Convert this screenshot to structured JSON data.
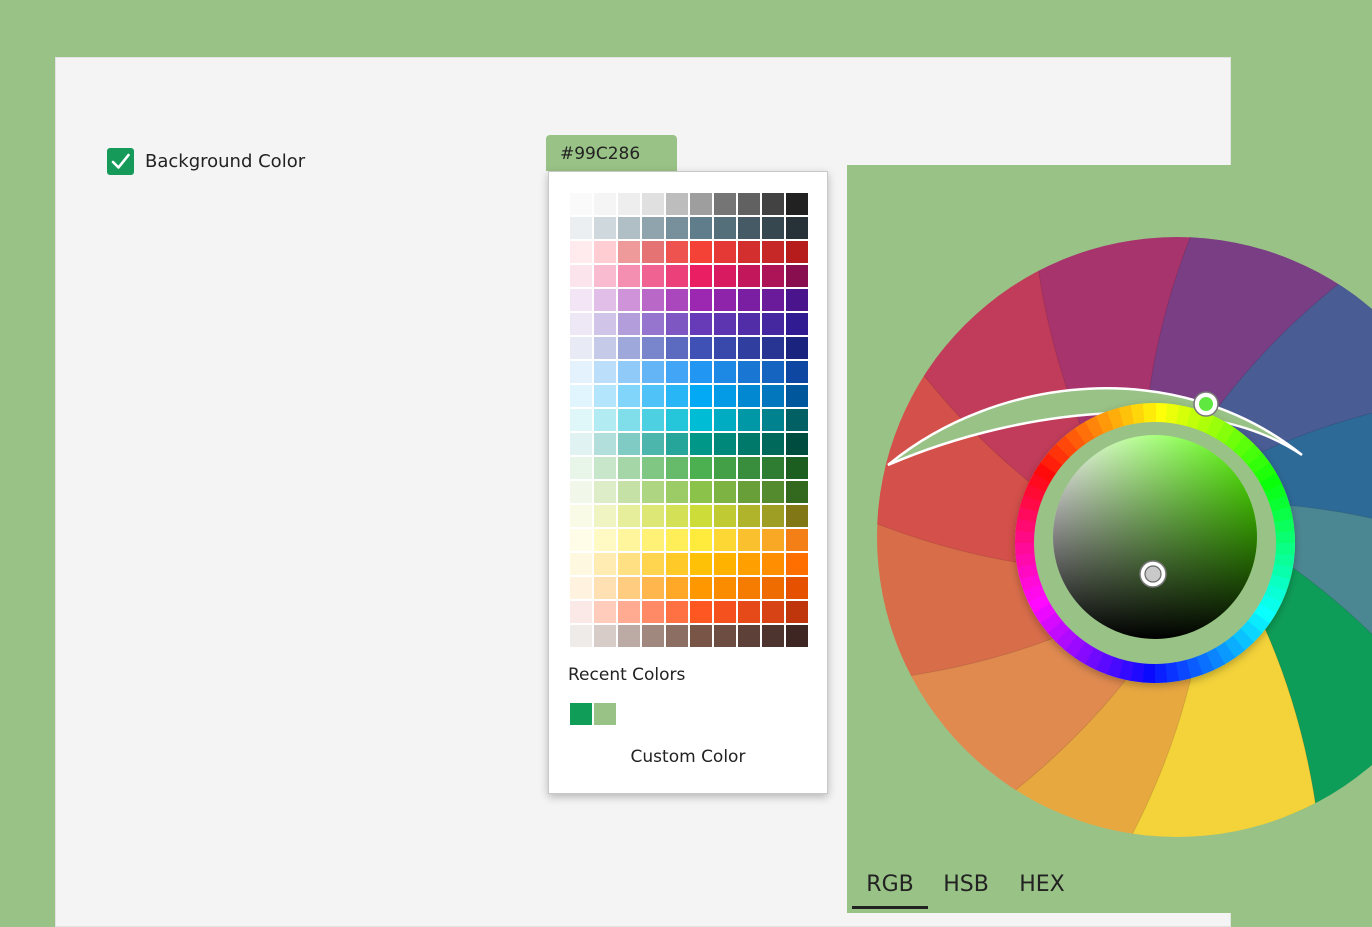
{
  "background_option": {
    "label": "Background Color",
    "checked": true
  },
  "current_color": {
    "hex": "#99C286"
  },
  "palette": {
    "swatch_rows": [
      [
        "#FAFAFA",
        "#F5F5F5",
        "#EEEEEE",
        "#E0E0E0",
        "#BDBDBD",
        "#9E9E9E",
        "#757575",
        "#616161",
        "#424242",
        "#212121"
      ],
      [
        "#ECEFF1",
        "#CFD8DC",
        "#B0BEC5",
        "#90A4AE",
        "#78909C",
        "#607D8B",
        "#546E7A",
        "#455A64",
        "#37474F",
        "#263238"
      ],
      [
        "#FFEBEE",
        "#FFCDD2",
        "#EF9A9A",
        "#E57373",
        "#EF5350",
        "#F44336",
        "#E53935",
        "#D32F2F",
        "#C62828",
        "#B71C1C"
      ],
      [
        "#FCE4EC",
        "#F8BBD0",
        "#F48FB1",
        "#F06292",
        "#EC407A",
        "#E91E63",
        "#D81B60",
        "#C2185B",
        "#AD1457",
        "#880E4F"
      ],
      [
        "#F3E5F5",
        "#E1BEE7",
        "#CE93D8",
        "#BA68C8",
        "#AB47BC",
        "#9C27B0",
        "#8E24AA",
        "#7B1FA2",
        "#6A1B9A",
        "#4A148C"
      ],
      [
        "#EDE7F6",
        "#D1C4E9",
        "#B39DDB",
        "#9575CD",
        "#7E57C2",
        "#673AB7",
        "#5E35B1",
        "#512DA8",
        "#4527A0",
        "#311B92"
      ],
      [
        "#E8EAF6",
        "#C5CAE9",
        "#9FA8DA",
        "#7986CB",
        "#5C6BC0",
        "#3F51B5",
        "#3949AB",
        "#303F9F",
        "#283593",
        "#1A237E"
      ],
      [
        "#E3F2FD",
        "#BBDEFB",
        "#90CAF9",
        "#64B5F6",
        "#42A5F5",
        "#2196F3",
        "#1E88E5",
        "#1976D2",
        "#1565C0",
        "#0D47A1"
      ],
      [
        "#E1F5FE",
        "#B3E5FC",
        "#81D4FA",
        "#4FC3F7",
        "#29B6F6",
        "#03A9F4",
        "#039BE5",
        "#0288D1",
        "#0277BD",
        "#01579B"
      ],
      [
        "#E0F7FA",
        "#B2EBF2",
        "#80DEEA",
        "#4DD0E1",
        "#26C6DA",
        "#00BCD4",
        "#00ACC1",
        "#0097A7",
        "#00838F",
        "#006064"
      ],
      [
        "#E0F2F1",
        "#B2DFDB",
        "#80CBC4",
        "#4DB6AC",
        "#26A69A",
        "#009688",
        "#00897B",
        "#00796B",
        "#00695C",
        "#004D40"
      ],
      [
        "#E8F5E9",
        "#C8E6C9",
        "#A5D6A7",
        "#81C784",
        "#66BB6A",
        "#4CAF50",
        "#43A047",
        "#388E3C",
        "#2E7D32",
        "#1B5E20"
      ],
      [
        "#F1F8E9",
        "#DCEDC8",
        "#C5E1A5",
        "#AED581",
        "#9CCC65",
        "#8BC34A",
        "#7CB342",
        "#689F38",
        "#558B2F",
        "#33691E"
      ],
      [
        "#F9FBE7",
        "#F0F4C3",
        "#E6EE9C",
        "#DCE775",
        "#D4E157",
        "#CDDC39",
        "#C0CA33",
        "#AFB42B",
        "#9E9D24",
        "#827717"
      ],
      [
        "#FFFDE7",
        "#FFF9C4",
        "#FFF59D",
        "#FFF176",
        "#FFEE58",
        "#FFEB3B",
        "#FDD835",
        "#FBC02D",
        "#F9A825",
        "#F57F17"
      ],
      [
        "#FFF8E1",
        "#FFECB3",
        "#FFE082",
        "#FFD54F",
        "#FFCA28",
        "#FFC107",
        "#FFB300",
        "#FFA000",
        "#FF8F00",
        "#FF6F00"
      ],
      [
        "#FFF3E0",
        "#FFE0B2",
        "#FFCC80",
        "#FFB74D",
        "#FFA726",
        "#FF9800",
        "#FB8C00",
        "#F57C00",
        "#EF6C00",
        "#E65100"
      ],
      [
        "#FBE9E7",
        "#FFCCBC",
        "#FFAB91",
        "#FF8A65",
        "#FF7043",
        "#FF5722",
        "#F4511E",
        "#E64A19",
        "#D84315",
        "#BF360C"
      ],
      [
        "#EFEBE9",
        "#D7CCC8",
        "#BCAAA4",
        "#A1887F",
        "#8D6E63",
        "#795548",
        "#6D4C41",
        "#5D4037",
        "#4E342E",
        "#3E2723"
      ]
    ],
    "recent_label": "Recent Colors",
    "recent_colors": [
      "#0F9D58",
      "#99C286"
    ],
    "custom_label": "Custom Color"
  },
  "wheel": {
    "petal_colors": [
      "#E8A840",
      "#E08A50",
      "#D86D4A",
      "#D4504A",
      "#C03C5A",
      "#A8346E",
      "#7A3E84",
      "#4A5C94",
      "#2E6A98",
      "#4B8792",
      "#0E9D58",
      "#F3D23A"
    ],
    "selected_hue_color": "#5FE840",
    "selected_shade_color": "#C9C9C9",
    "hue": 100,
    "saturation": 0.21,
    "brightness": 0.76
  },
  "tabs": [
    {
      "label": "RGB",
      "active": true
    },
    {
      "label": "HSB",
      "active": false
    },
    {
      "label": "HEX",
      "active": false
    }
  ]
}
